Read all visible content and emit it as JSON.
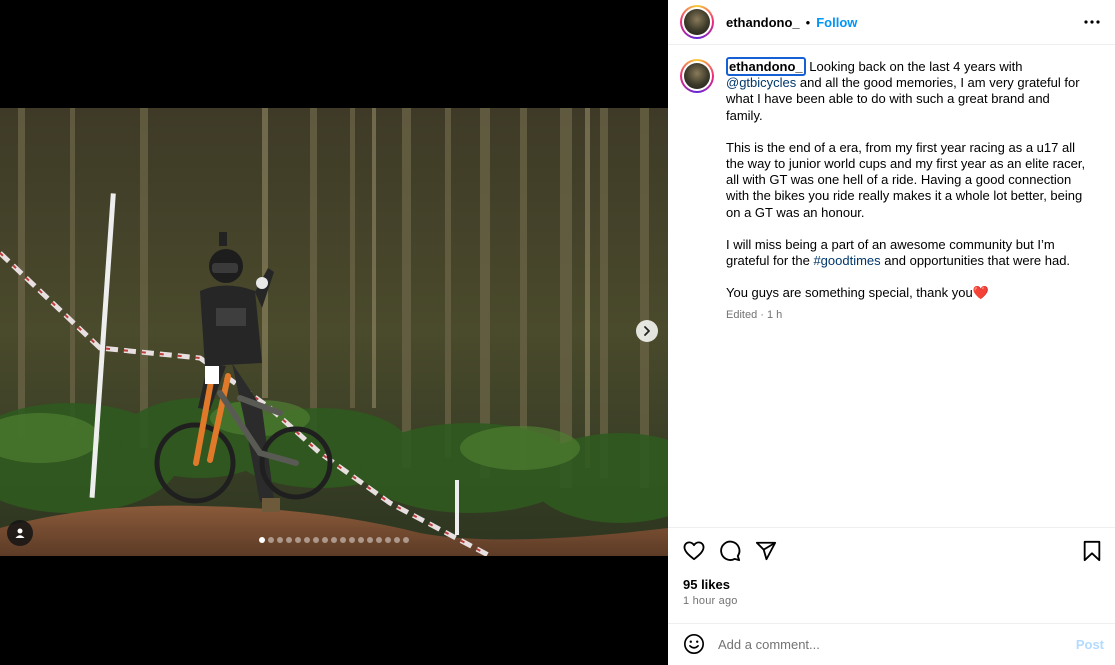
{
  "post": {
    "username": "ethandono_",
    "follow_label": "Follow",
    "separator": "•",
    "caption_text": "Looking back on the last 4 years with",
    "mention": "@gtbicycles",
    "caption_text_2": "and all the good memories, I am very grateful for what I have been able to do with such a great brand and family.",
    "paragraph_2": "This is the end of a era, from my first year racing as a u17 all the way to junior world cups and my first year as an elite racer, all with GT was one hell of a ride. Having a good connection with the bikes you ride really makes it a whole lot better, being on a GT was an honour.",
    "paragraph_3_a": "I will miss being a part of an awesome community but I’m grateful for the",
    "hashtag": "#goodtimes",
    "paragraph_3_b": "and opportunities that were had.",
    "paragraph_4": "You guys are something special, thank you❤️",
    "edited_meta": "Edited · 1 h",
    "likes": "95 likes",
    "time_ago": "1 hour ago"
  },
  "comment": {
    "placeholder": "Add a comment...",
    "post_label": "Post"
  },
  "carousel": {
    "total_slides": 17,
    "active_index": 0
  },
  "icons": {
    "more": "more-options-icon",
    "like": "heart-icon",
    "comment": "comment-bubble-icon",
    "share": "paper-plane-icon",
    "save": "bookmark-icon",
    "emoji": "emoji-icon",
    "next": "chevron-right-icon",
    "tagged": "user-tag-icon"
  },
  "colors": {
    "link": "#00376b",
    "follow": "#0095f6",
    "post_disabled": "#b3dbff",
    "heart": "#e0245e"
  }
}
